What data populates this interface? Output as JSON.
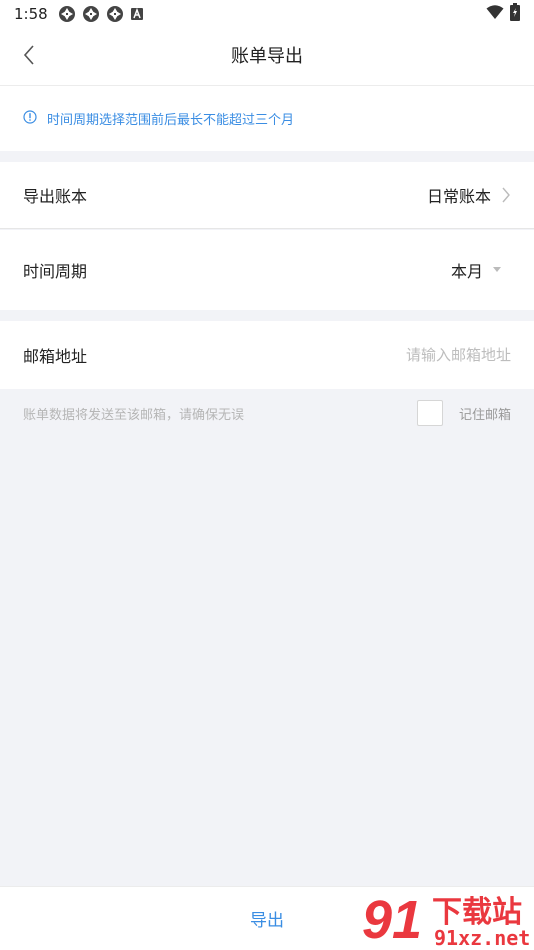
{
  "status_bar": {
    "time": "1:58",
    "icons": [
      "aperture-icon",
      "aperture-icon",
      "aperture-icon",
      "a-badge-icon"
    ],
    "right_icons": [
      "wifi-icon",
      "battery-icon"
    ]
  },
  "nav": {
    "title": "账单导出",
    "back_icon": "chevron-left-icon"
  },
  "notice": {
    "icon": "info-icon",
    "text": "时间周期选择范围前后最长不能超过三个月"
  },
  "form": {
    "ledger": {
      "label": "导出账本",
      "value": "日常账本",
      "icon": "chevron-right-icon"
    },
    "period": {
      "label": "时间周期",
      "value": "本月",
      "icon": "caret-down-icon"
    },
    "email": {
      "label": "邮箱地址",
      "value": "",
      "placeholder": "请输入邮箱地址"
    }
  },
  "hint": {
    "text": "账单数据将发送至该邮箱，请确保无误",
    "remember_label": "记住邮箱",
    "remember_checked": false
  },
  "bottom": {
    "export_label": "导出"
  },
  "watermark": {
    "logo_text": "91",
    "brand": "下载站",
    "domain": "91xz.net"
  },
  "colors": {
    "accent": "#3a8de3",
    "background": "#f2f3f7",
    "watermark_red": "#e8232b"
  }
}
